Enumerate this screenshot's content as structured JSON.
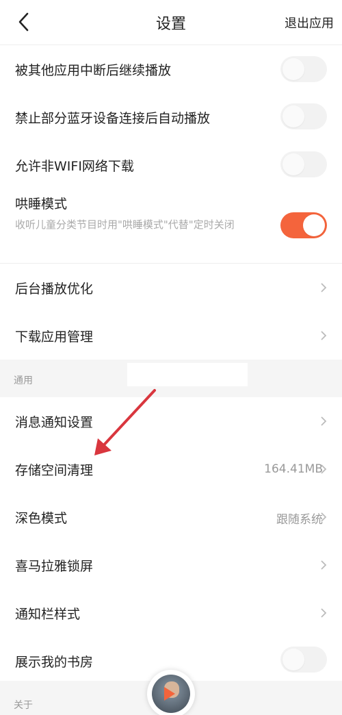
{
  "header": {
    "title": "设置",
    "exit_label": "退出应用"
  },
  "toggles": [
    {
      "label": "被其他应用中断后继续播放",
      "on": false
    },
    {
      "label": "禁止部分蓝牙设备连接后自动播放",
      "on": false
    },
    {
      "label": "允许非WIFI网络下载",
      "on": false
    },
    {
      "label": "哄睡模式",
      "desc": "收听儿童分类节目时用\"哄睡模式\"代替\"定时关闭",
      "on": true
    }
  ],
  "nav_top": [
    {
      "label": "后台播放优化"
    },
    {
      "label": "下载应用管理"
    }
  ],
  "sections": {
    "general": "通用",
    "about": "关于"
  },
  "general_items": [
    {
      "label": "消息通知设置",
      "value": ""
    },
    {
      "label": "存储空间清理",
      "value": "164.41MB"
    },
    {
      "label": "深色模式",
      "value": "跟随系统"
    },
    {
      "label": "喜马拉雅锁屏",
      "value": ""
    },
    {
      "label": "通知栏样式",
      "value": ""
    },
    {
      "label": "展示我的书房",
      "value": ""
    }
  ],
  "colors": {
    "accent": "#f4643c",
    "annotation_arrow": "#d9363e",
    "section_bg": "#f5f5f5"
  },
  "icons": {
    "back": "chevron-left-icon",
    "row_arrow": "chevron-right-icon",
    "player": "play-icon"
  }
}
